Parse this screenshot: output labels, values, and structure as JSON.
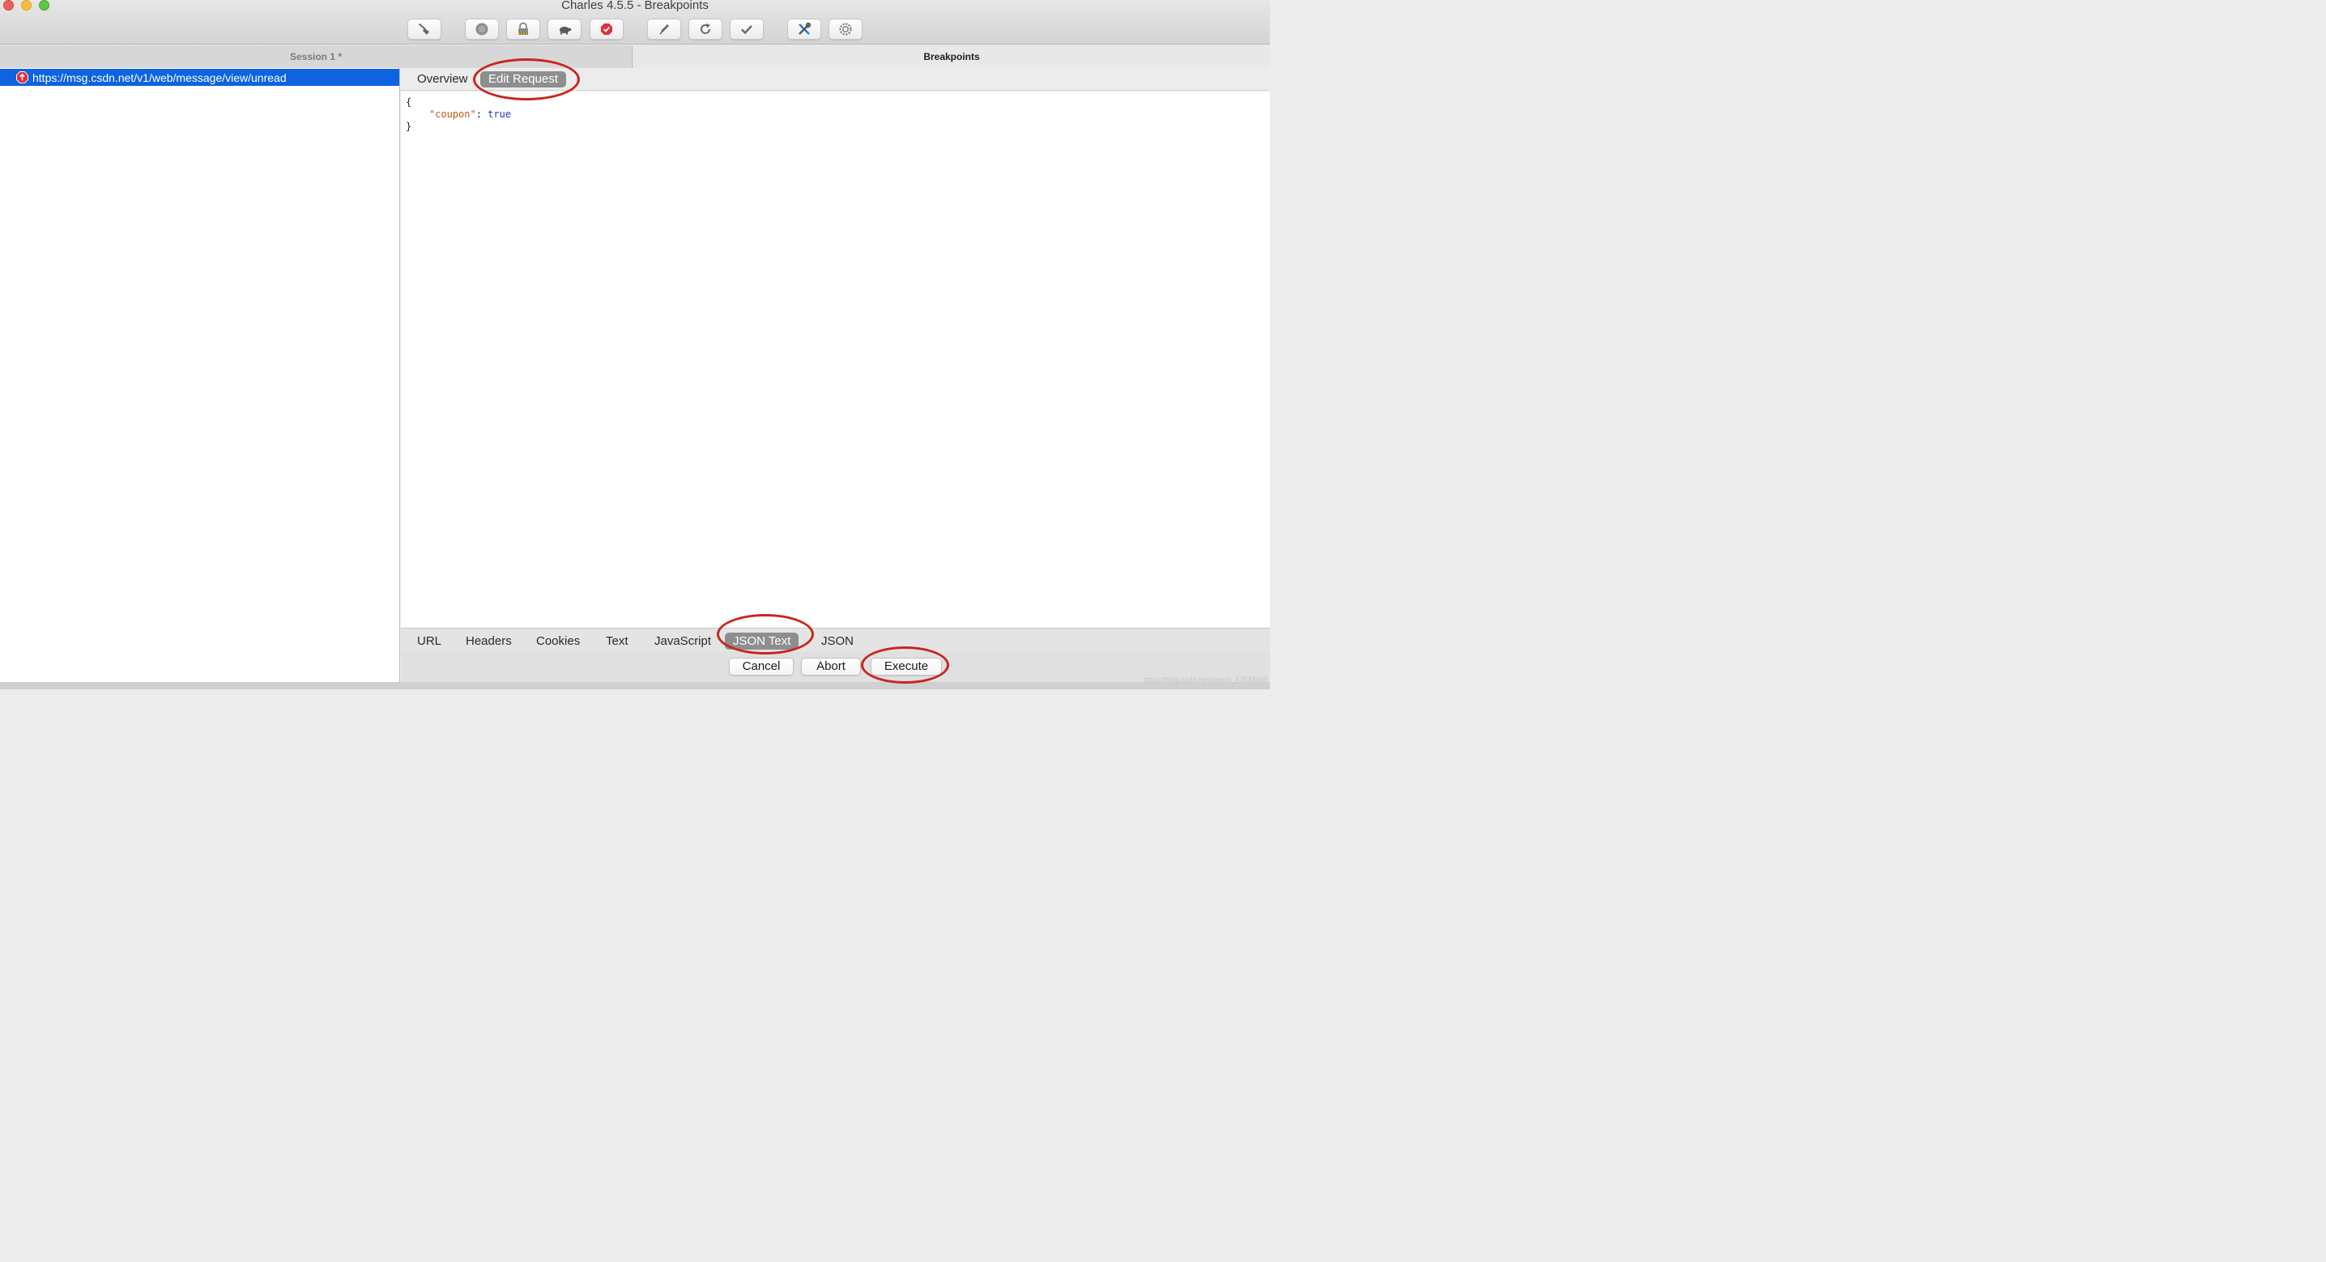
{
  "window": {
    "title": "Charles 4.5.5 - Breakpoints"
  },
  "toolbar": {
    "buttons": [
      {
        "name": "broom-icon"
      },
      {
        "name": "record-icon"
      },
      {
        "name": "ssl-lock-icon"
      },
      {
        "name": "turtle-icon"
      },
      {
        "name": "breakpoint-icon"
      },
      {
        "name": "pen-icon"
      },
      {
        "name": "repeat-icon"
      },
      {
        "name": "validate-checkmark-icon"
      },
      {
        "name": "tools-icon"
      },
      {
        "name": "settings-gear-icon"
      }
    ],
    "colors": {
      "breakpoint": "#e0303a",
      "accent": "#1f7ae0"
    }
  },
  "header": {
    "session_tab": "Session 1 *",
    "breakpoints_tab": "Breakpoints"
  },
  "session": {
    "selected_url": "https://msg.csdn.net/v1/web/message/view/unread",
    "selection_color": "#0d63e0"
  },
  "request": {
    "tabs": {
      "overview": "Overview",
      "edit_request": "Edit Request"
    },
    "body_lines": {
      "open": "{",
      "key": "\"coupon\"",
      "colon": ": ",
      "value": "true",
      "close": "}"
    },
    "view_tabs": {
      "url": "URL",
      "headers": "Headers",
      "cookies": "Cookies",
      "text": "Text",
      "javascript": "JavaScript",
      "json_text": "JSON Text",
      "json": "JSON"
    },
    "actions": {
      "cancel": "Cancel",
      "abort": "Abort",
      "execute": "Execute"
    }
  },
  "watermark": "https://blog.csdn.net/weixin_47534949"
}
